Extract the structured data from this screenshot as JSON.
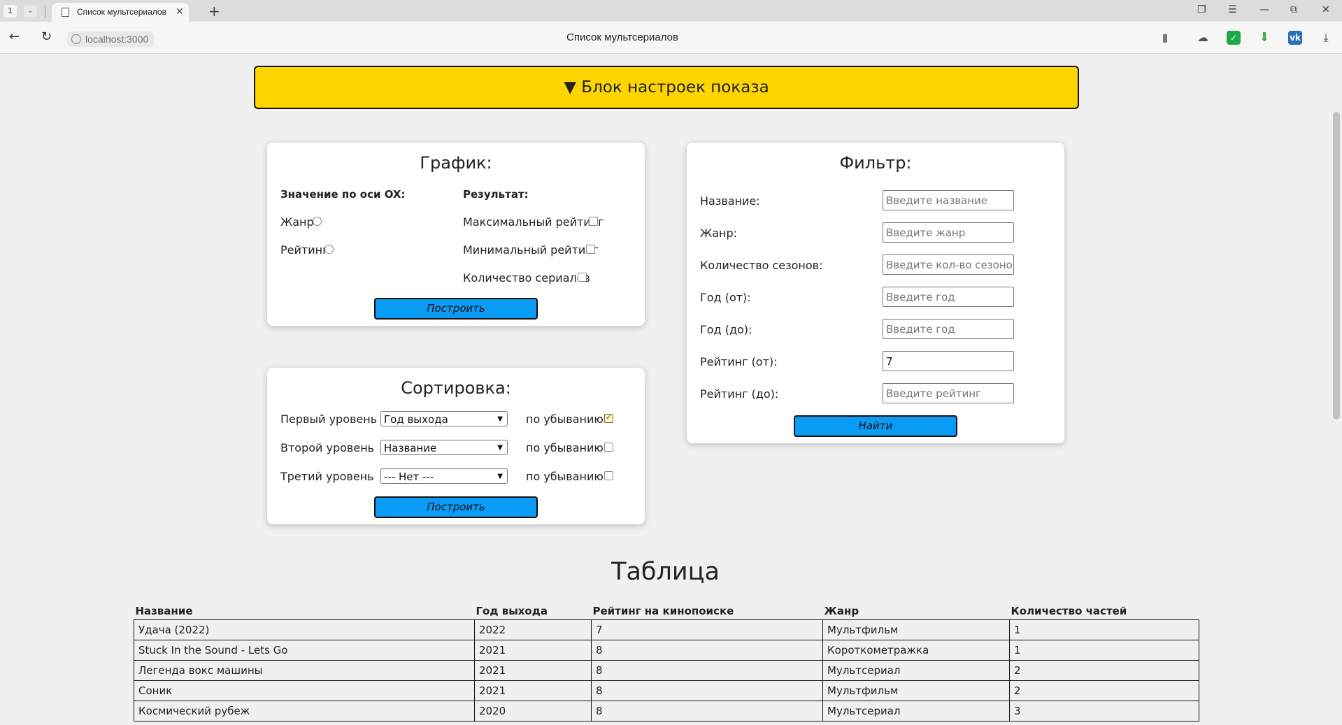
{
  "browser": {
    "tab_count": "1",
    "tab_title": "Список мультсериалов",
    "url": "localhost:3000",
    "page_title": "Список мультсериалов"
  },
  "settings_toggle": "▼ Блок настроек показа",
  "chart_panel": {
    "title": "График:",
    "ox_heading": "Значение по оси OX:",
    "ox_options": [
      "Жанр",
      "Рейтинг"
    ],
    "result_heading": "Результат:",
    "result_options": [
      "Максимальный рейтинг",
      "Минимальный рейтинг",
      "Количество сериалов"
    ],
    "build_button": "Построить"
  },
  "sort_panel": {
    "title": "Сортировка:",
    "levels": [
      {
        "label": "Первый уровень",
        "selected": "Год выхода",
        "desc_label": "по убыванию?",
        "desc_checked": true
      },
      {
        "label": "Второй уровень",
        "selected": "Название",
        "desc_label": "по убыванию?",
        "desc_checked": false
      },
      {
        "label": "Третий уровень",
        "selected": "--- Нет ---",
        "desc_label": "по убыванию?",
        "desc_checked": false
      }
    ],
    "build_button": "Построить"
  },
  "filter_panel": {
    "title": "Фильтр:",
    "fields": [
      {
        "label": "Название:",
        "placeholder": "Введите название",
        "value": ""
      },
      {
        "label": "Жанр:",
        "placeholder": "Введите жанр",
        "value": ""
      },
      {
        "label": "Количество сезонов:",
        "placeholder": "Введите кол-во сезонов",
        "value": ""
      },
      {
        "label": "Год (от):",
        "placeholder": "Введите год",
        "value": ""
      },
      {
        "label": "Год (до):",
        "placeholder": "Введите год",
        "value": ""
      },
      {
        "label": "Рейтинг (от):",
        "placeholder": "Введите рейтинг",
        "value": "7"
      },
      {
        "label": "Рейтинг (до):",
        "placeholder": "Введите рейтинг",
        "value": ""
      }
    ],
    "find_button": "Найти"
  },
  "table": {
    "title": "Таблица",
    "columns": [
      "Название",
      "Год выхода",
      "Рейтинг на кинопоиске",
      "Жанр",
      "Количество частей"
    ],
    "rows": [
      [
        "Удача (2022)",
        "2022",
        "7",
        "Мультфильм",
        "1"
      ],
      [
        "Stuck In the Sound - Lets Go",
        "2021",
        "8",
        "Короткометражка",
        "1"
      ],
      [
        "Легенда вокс машины",
        "2021",
        "8",
        "Мультсериал",
        "2"
      ],
      [
        "Соник",
        "2021",
        "8",
        "Мультфильм",
        "2"
      ],
      [
        "Космический рубеж",
        "2020",
        "8",
        "Мультсериал",
        "3"
      ]
    ]
  }
}
